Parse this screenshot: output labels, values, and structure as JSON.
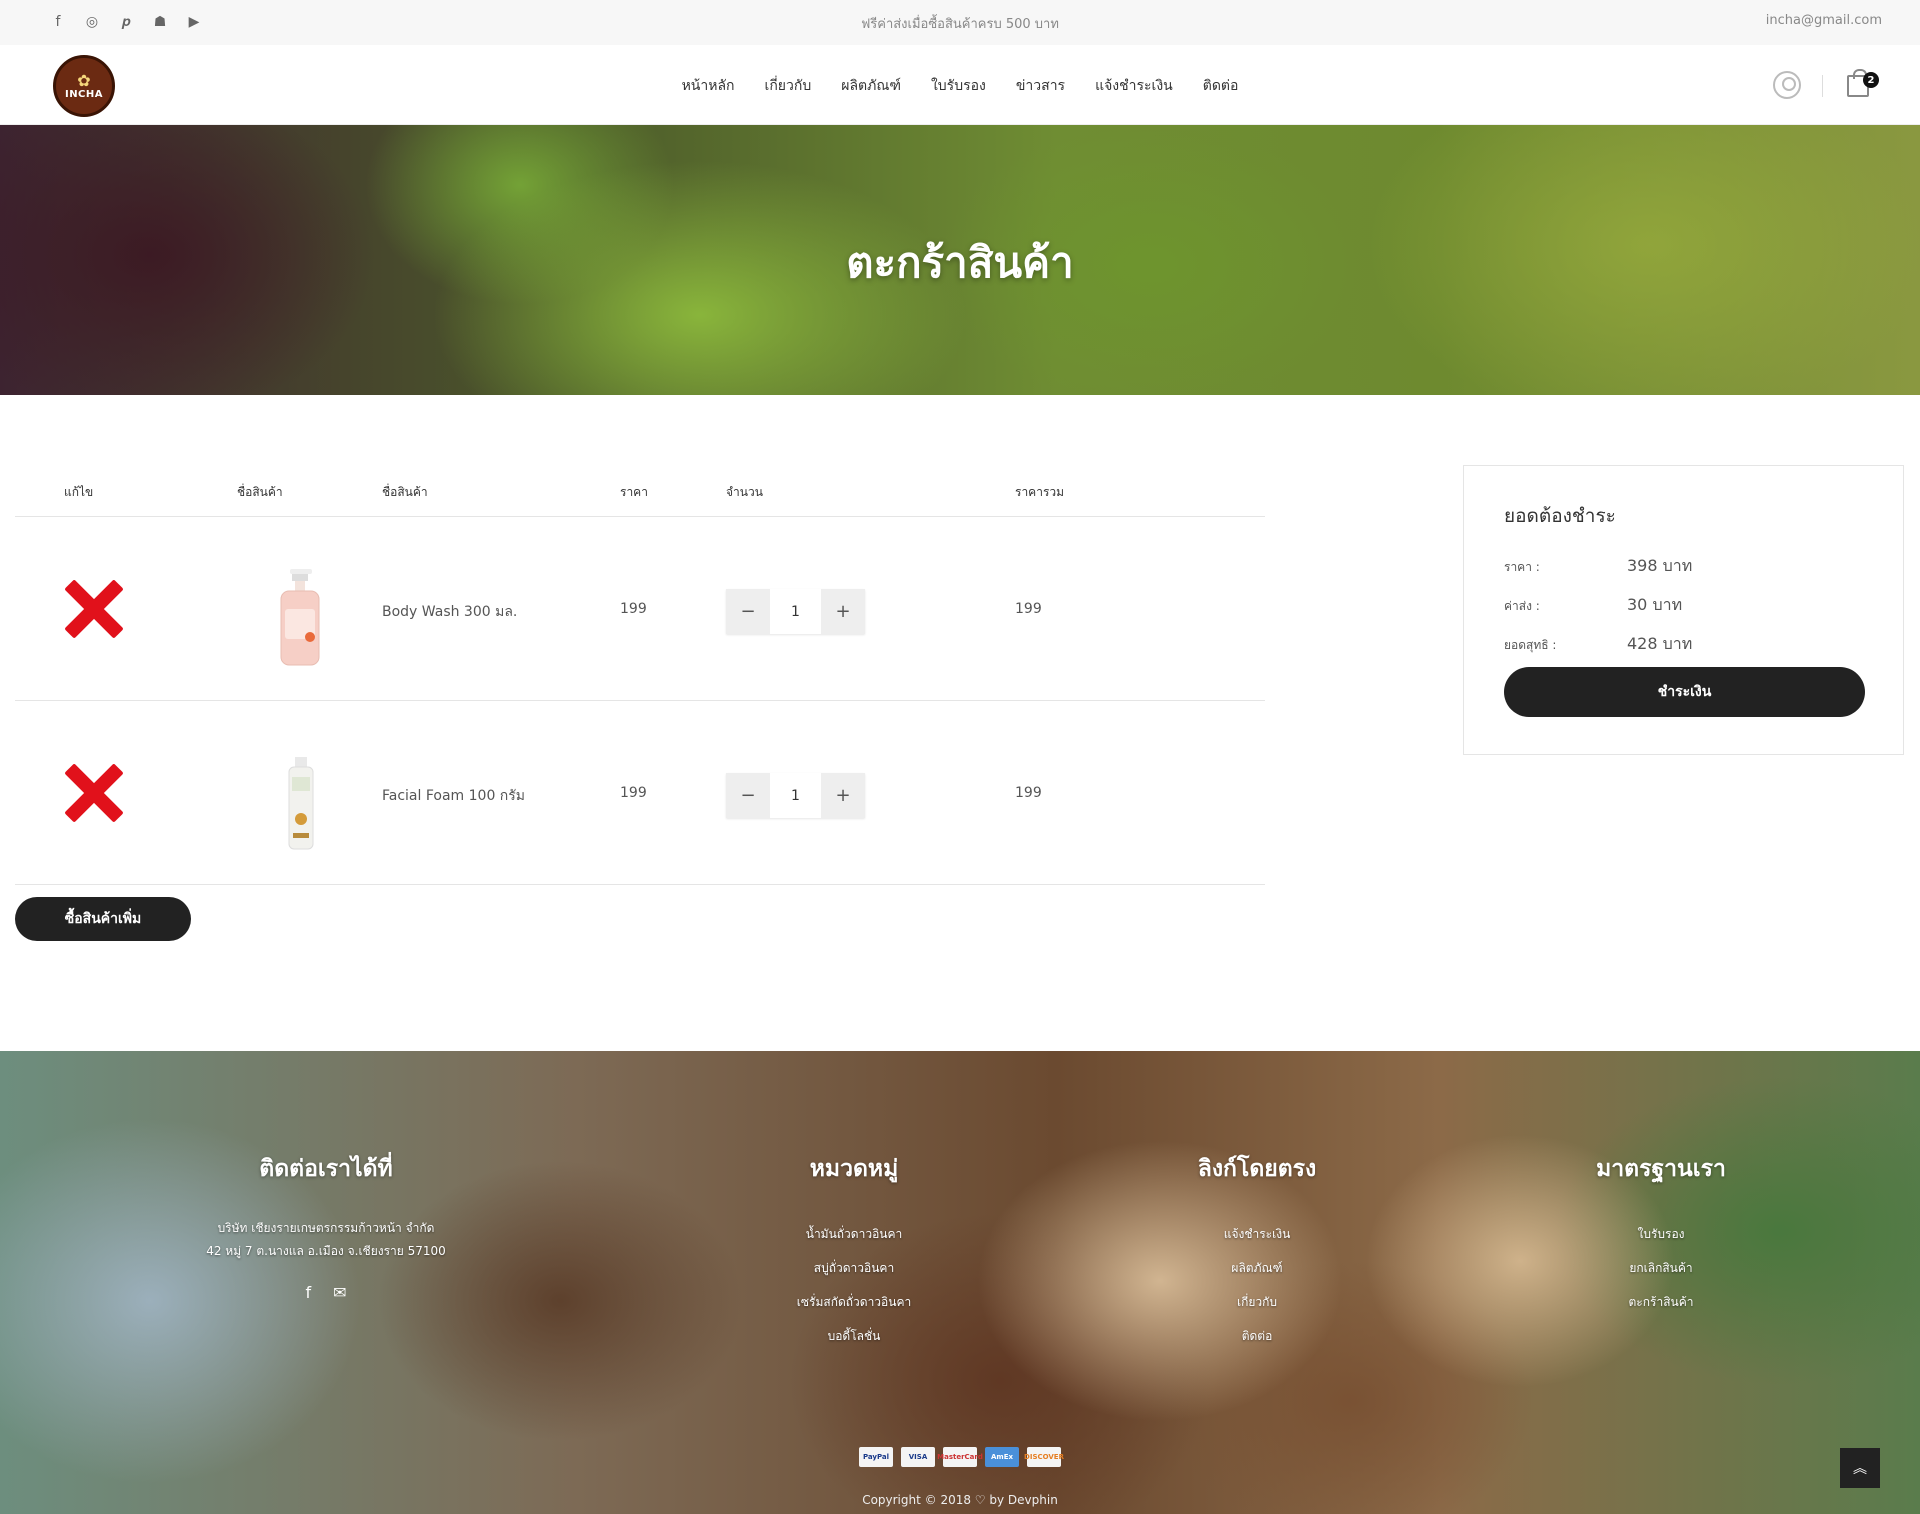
{
  "topbar": {
    "social_icons": [
      "facebook-icon",
      "instagram-icon",
      "pinterest-icon",
      "snapchat-icon",
      "youtube-icon"
    ],
    "promo": "ฟรีค่าส่งเมื่อซื้อสินค้าครบ 500 บาท",
    "email": "incha@gmail.com"
  },
  "header": {
    "logo_text": "INCHA",
    "nav": [
      "หน้าหลัก",
      "เกี่ยวกับ",
      "ผลิตภัณฑ์",
      "ใบรับรอง",
      "ข่าวสาร",
      "แจ้งชำระเงิน",
      "ติดต่อ"
    ],
    "cart_count": "2"
  },
  "hero": {
    "title": "ตะกร้าสินค้า"
  },
  "cart": {
    "headers": [
      "แก้ไข",
      "ชื่อสินค้า",
      "ชื่อสินค้า",
      "ราคา",
      "จำนวน",
      "ราคารวม"
    ],
    "items": [
      {
        "name": "Body Wash 300 มล.",
        "price": "199",
        "qty": "1",
        "total": "199"
      },
      {
        "name": "Facial Foam 100 กรัม",
        "price": "199",
        "qty": "1",
        "total": "199"
      }
    ],
    "continue_label": "ซื้อสินค้าเพิ่ม"
  },
  "summary": {
    "title": "ยอดต้องชำระ",
    "price_label": "ราคา :",
    "price_value": "398 บาท",
    "shipping_label": "ค่าส่ง :",
    "shipping_value": "30 บาท",
    "net_label": "ยอดสุทธิ :",
    "net_value": "428 บาท",
    "pay_label": "ชำระเงิน"
  },
  "footer": {
    "contact": {
      "title": "ติดต่อเราได้ที่",
      "address1": "บริษัท เชียงรายเกษตรกรรมก้าวหน้า จำกัด",
      "address2": "42 หมู่ 7 ต.นางแล อ.เมือง จ.เชียงราย 57100"
    },
    "categories": {
      "title": "หมวดหมู่",
      "items": [
        "น้ำมันถั่วดาวอินคา",
        "สบู่ถั่วดาวอินคา",
        "เซรั่มสกัดถั่วดาวอินคา",
        "บอดี้โลชั่น"
      ]
    },
    "links": {
      "title": "ลิงก์โดยตรง",
      "items": [
        "แจ้งชำระเงิน",
        "ผลิตภัณฑ์",
        "เกี่ยวกับ",
        "ติดต่อ"
      ]
    },
    "standards": {
      "title": "มาตรฐานเรา",
      "items": [
        "ใบรับรอง",
        "ยกเลิกสินค้า",
        "ตะกร้าสินค้า"
      ]
    },
    "payments": [
      "PayPal",
      "VISA",
      "MasterCard",
      "AmEx",
      "DISCOVER"
    ],
    "copyright": "Copyright © 2018 ♡ by Devphin"
  },
  "colors": {
    "accent_dark": "#222222",
    "remove_red": "#e1111b",
    "brand_brown": "#6b2a12"
  }
}
